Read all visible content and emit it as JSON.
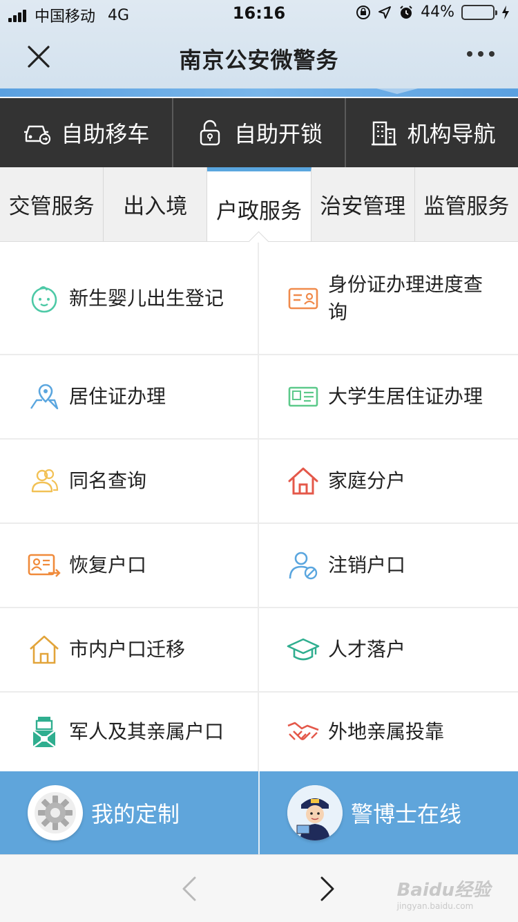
{
  "status_bar": {
    "carrier": "中国移动",
    "network": "4G",
    "time": "16:16",
    "battery_percent": "44%",
    "battery_level": 0.44
  },
  "navbar": {
    "title": "南京公安微警务"
  },
  "quick_actions": [
    {
      "label": "自助移车",
      "icon": "car-icon"
    },
    {
      "label": "自助开锁",
      "icon": "lock-icon"
    },
    {
      "label": "机构导航",
      "icon": "building-icon"
    }
  ],
  "tabs": [
    {
      "label": "交管服务",
      "active": false
    },
    {
      "label": "出入境",
      "active": false
    },
    {
      "label": "户政服务",
      "active": true
    },
    {
      "label": "治安管理",
      "active": false
    },
    {
      "label": "监管服务",
      "active": false
    }
  ],
  "services": [
    {
      "label": "新生婴儿出生登记",
      "icon": "baby-icon",
      "color": "#4dc9a6"
    },
    {
      "label": "身份证办理进度查询",
      "icon": "id-card-icon",
      "color": "#f08a4b"
    },
    {
      "label": "居住证办理",
      "icon": "map-pin-icon",
      "color": "#5aa6df"
    },
    {
      "label": "大学生居住证办理",
      "icon": "student-card-icon",
      "color": "#5cc98a"
    },
    {
      "label": "同名查询",
      "icon": "people-icon",
      "color": "#f2c155"
    },
    {
      "label": "家庭分户",
      "icon": "house-icon",
      "color": "#e4584a"
    },
    {
      "label": "恢复户口",
      "icon": "id-restore-icon",
      "color": "#f08a3a"
    },
    {
      "label": "注销户口",
      "icon": "user-cancel-icon",
      "color": "#5aa6df"
    },
    {
      "label": "市内户口迁移",
      "icon": "home-outline-icon",
      "color": "#e2a43a"
    },
    {
      "label": "人才落户",
      "icon": "graduation-cap-icon",
      "color": "#2fae8f"
    },
    {
      "label": "军人及其亲属户口",
      "icon": "soldier-icon",
      "color": "#2fae8f"
    },
    {
      "label": "外地亲属投靠",
      "icon": "handshake-icon",
      "color": "#e4584a"
    }
  ],
  "bottom_buttons": [
    {
      "label": "我的定制",
      "icon": "gear-icon"
    },
    {
      "label": "警博士在线",
      "icon": "police-avatar-icon"
    }
  ],
  "watermark": {
    "brand": "Baidu经验",
    "url": "jingyan.baidu.com"
  },
  "colors": {
    "accent": "#5aa6df",
    "quickbar": "#333333",
    "bottom_button": "#5fa5db"
  }
}
